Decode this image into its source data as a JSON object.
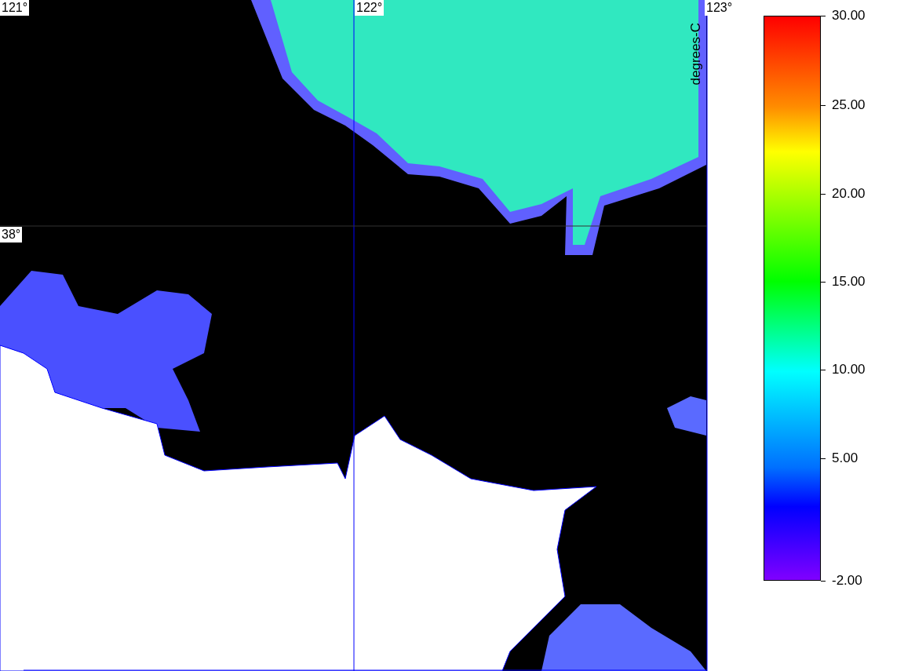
{
  "map": {
    "grid_labels": [
      {
        "kind": "lon",
        "text": "121°"
      },
      {
        "kind": "lon",
        "text": "122°"
      },
      {
        "kind": "lon",
        "text": "123°"
      },
      {
        "kind": "lat",
        "text": "38°"
      }
    ]
  },
  "colorbar": {
    "title": "degrees-C",
    "ticks": [
      "30.00",
      "25.00",
      "20.00",
      "15.00",
      "10.00",
      "5.00",
      "-2.00"
    ]
  }
}
